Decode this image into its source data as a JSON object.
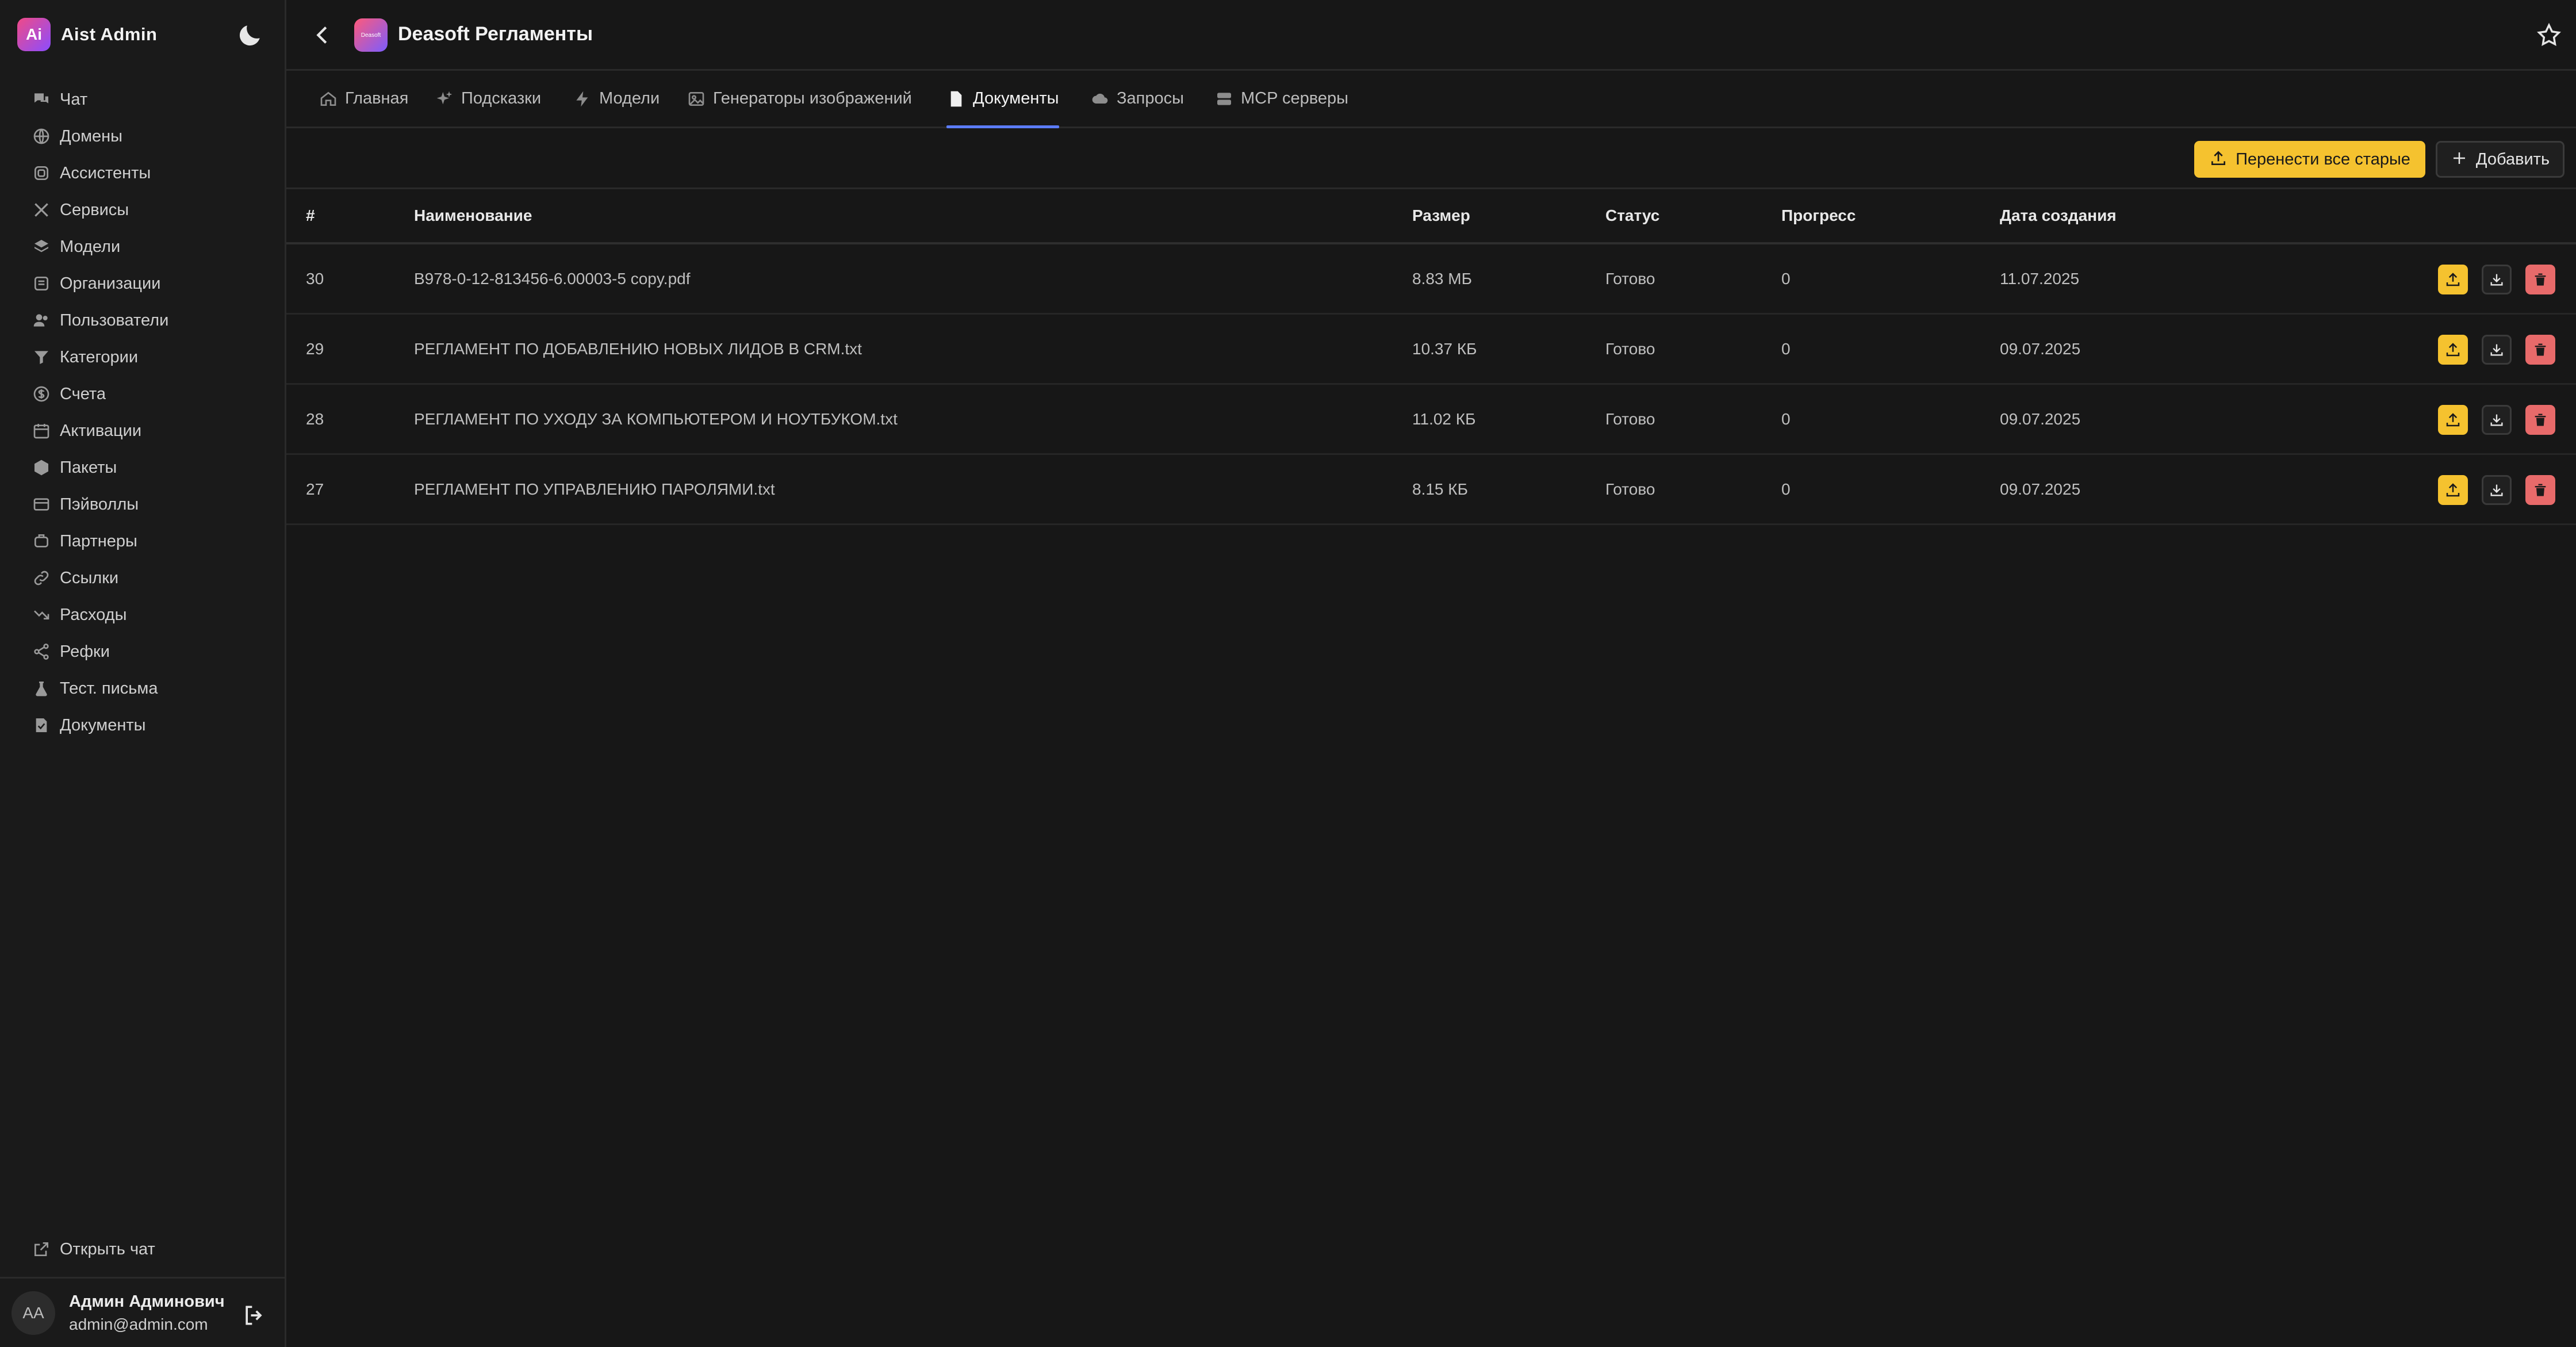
{
  "app": {
    "brand_logo": "Ai",
    "brand_name": "Aist Admin"
  },
  "sidebar": {
    "items": [
      {
        "label": "Чат",
        "icon": "chat-icon"
      },
      {
        "label": "Домены",
        "icon": "globe-icon"
      },
      {
        "label": "Ассистенты",
        "icon": "robot-icon"
      },
      {
        "label": "Сервисы",
        "icon": "tools-icon"
      },
      {
        "label": "Модели",
        "icon": "layers-icon"
      },
      {
        "label": "Организации",
        "icon": "building-icon"
      },
      {
        "label": "Пользователи",
        "icon": "users-icon"
      },
      {
        "label": "Категории",
        "icon": "filter-icon"
      },
      {
        "label": "Счета",
        "icon": "dollar-icon"
      },
      {
        "label": "Активации",
        "icon": "calendar-icon"
      },
      {
        "label": "Пакеты",
        "icon": "box-icon"
      },
      {
        "label": "Пэйволлы",
        "icon": "card-icon"
      },
      {
        "label": "Партнеры",
        "icon": "handshake-icon"
      },
      {
        "label": "Ссылки",
        "icon": "link-icon"
      },
      {
        "label": "Расходы",
        "icon": "trend-icon"
      },
      {
        "label": "Рефки",
        "icon": "share-icon"
      },
      {
        "label": "Тест. письма",
        "icon": "flask-icon"
      },
      {
        "label": "Документы",
        "icon": "doc-check-icon"
      }
    ],
    "open_chat": "Открыть чат"
  },
  "user": {
    "initials": "AA",
    "name": "Админ Админович",
    "email": "admin@admin.com"
  },
  "header": {
    "title": "Deasoft Регламенты",
    "logo_text": "Deasoft"
  },
  "tabs": [
    {
      "label": "Главная",
      "icon": "home-icon",
      "active": false
    },
    {
      "label": "Подсказки",
      "icon": "sparkles-icon",
      "active": false
    },
    {
      "label": "Модели",
      "icon": "bolt-icon",
      "active": false
    },
    {
      "label": "Генераторы изображений",
      "icon": "image-icon",
      "active": false
    },
    {
      "label": "Документы",
      "icon": "document-icon",
      "active": true
    },
    {
      "label": "Запросы",
      "icon": "cloud-icon",
      "active": false
    },
    {
      "label": "MCP серверы",
      "icon": "server-icon",
      "active": false
    }
  ],
  "toolbar": {
    "migrate_label": "Перенести все старые",
    "add_label": "Добавить"
  },
  "table": {
    "headers": {
      "id": "#",
      "name": "Наименование",
      "size": "Размер",
      "status": "Статус",
      "progress": "Прогресс",
      "date": "Дата создания"
    },
    "rows": [
      {
        "id": "30",
        "name": "B978-0-12-813456-6.00003-5 copy.pdf",
        "size": "8.83 МБ",
        "status": "Готово",
        "progress": "0",
        "date": "11.07.2025"
      },
      {
        "id": "29",
        "name": "РЕГЛАМЕНТ ПО ДОБАВЛЕНИЮ НОВЫХ ЛИДОВ В CRM.txt",
        "size": "10.37 КБ",
        "status": "Готово",
        "progress": "0",
        "date": "09.07.2025"
      },
      {
        "id": "28",
        "name": "РЕГЛАМЕНТ ПО УХОДУ ЗА КОМПЬЮТЕРОМ И НОУТБУКОМ.txt",
        "size": "11.02 КБ",
        "status": "Готово",
        "progress": "0",
        "date": "09.07.2025"
      },
      {
        "id": "27",
        "name": "РЕГЛАМЕНТ ПО УПРАВЛЕНИЮ ПАРОЛЯМИ.txt",
        "size": "8.15 КБ",
        "status": "Готово",
        "progress": "0",
        "date": "09.07.2025"
      }
    ]
  },
  "colors": {
    "background": "#171717",
    "accent_yellow": "#f5c22f",
    "danger": "#e86a6a",
    "tab_underline": "#5b7cfa"
  }
}
